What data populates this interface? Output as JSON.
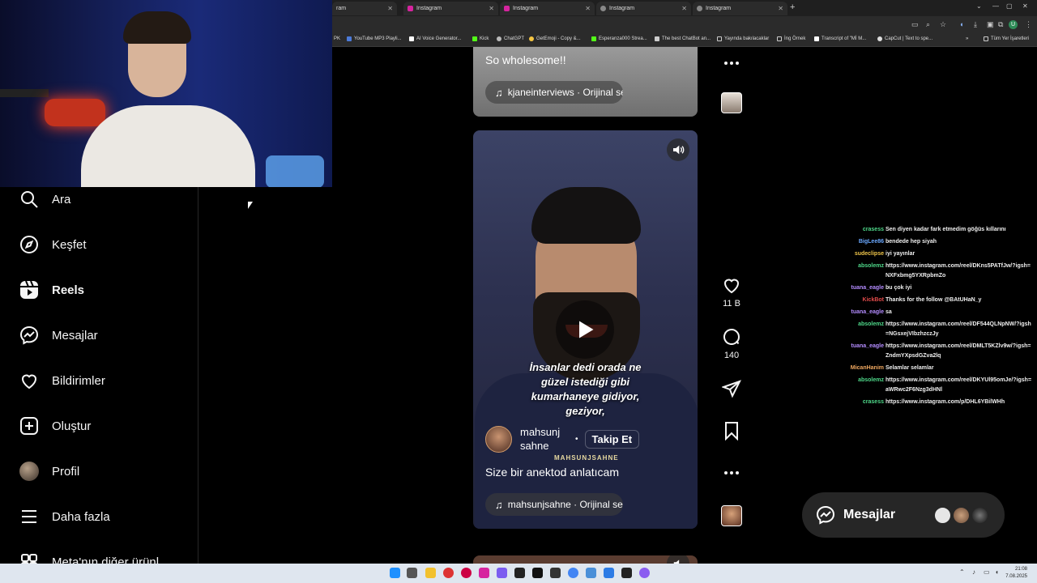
{
  "browser": {
    "tabs": [
      {
        "label": "ram"
      },
      {
        "label": "Instagram"
      },
      {
        "label": "Instagram"
      },
      {
        "label": "Instagram"
      },
      {
        "label": "Instagram"
      }
    ],
    "bookmarks": [
      "PK",
      "YouTube MP3 Playli...",
      "AI Voice Generator...",
      "Kick",
      "ChatGPT",
      "GetEmoji - Copy &...",
      "Esperanza000 Strea...",
      "The best ChatBot an...",
      "Yayında bakılacaklar",
      "İng Örnek",
      "Transcript of \"Mİ M...",
      "CapCut | Text to spe...",
      "»",
      "Tüm Yer İşaretleri"
    ],
    "profile_initial": "U"
  },
  "sidebar": {
    "items": [
      {
        "label": "Ara",
        "icon": "search-icon"
      },
      {
        "label": "Keşfet",
        "icon": "compass-icon"
      },
      {
        "label": "Reels",
        "icon": "reels-icon",
        "active": true
      },
      {
        "label": "Mesajlar",
        "icon": "messenger-icon"
      },
      {
        "label": "Bildirimler",
        "icon": "heart-icon"
      },
      {
        "label": "Oluştur",
        "icon": "plus-square-icon"
      },
      {
        "label": "Profil",
        "icon": "avatar"
      },
      {
        "label": "Daha fazla",
        "icon": "menu-icon"
      },
      {
        "label": "Meta'nın diğer ürünl",
        "icon": "meta-apps-icon"
      }
    ]
  },
  "reels": {
    "previous": {
      "caption": "So wholesome!!",
      "audio": "kjaneinterviews · Orijinal ses"
    },
    "current": {
      "overlay_text": [
        "İnsanlar dedi orada ne",
        "güzel istediği gibi",
        "kumarhaneye gidiyor,",
        "geziyor,"
      ],
      "author_line1": "mahsunj",
      "author_line2": "sahne",
      "dot": "•",
      "follow_label": "Takip Et",
      "watermark": "MAHSUNJSAHNE",
      "caption": "Size bir anektod anlatıcam",
      "audio": "mahsunjsahne · Orijinal ses",
      "likes": "11 B",
      "comments": "140"
    }
  },
  "chat": {
    "messages": [
      {
        "user": "crasess",
        "color": "#4fd98a",
        "text": "Sen diyen kadar fark etmedim göğüs kıllarını"
      },
      {
        "user": "BigLee86",
        "color": "#6aa8ff",
        "text": "bendede hep siyah"
      },
      {
        "user": "sudeclipse",
        "color": "#f0c64a",
        "text": "iyi yayınlar"
      },
      {
        "user": "absolemz",
        "color": "#4fd98a",
        "text": "https://www.instagram.com/reel/DKns5PATfJw/?igsh=NXFxbmg5YXRpbmZo"
      },
      {
        "user": "tuana_eagle",
        "color": "#b48cff",
        "text": "bu çok iyi"
      },
      {
        "user": "KickBot",
        "color": "#e24b4b",
        "text": "Thanks for the follow @BAtUHaN_y"
      },
      {
        "user": "tuana_eagle",
        "color": "#b48cff",
        "text": "sa"
      },
      {
        "user": "absolemz",
        "color": "#4fd98a",
        "text": "https://www.instagram.com/reel/DF544QLNpNW/?igsh=NGsxejVIbzhzczJy"
      },
      {
        "user": "tuana_eagle",
        "color": "#b48cff",
        "text": "https://www.instagram.com/reel/DMLT5KZlv9w/?igsh=ZndmYXpsdGZva2lq"
      },
      {
        "user": "MicanHanim",
        "color": "#f0a860",
        "text": "Selamlar selamlar"
      },
      {
        "user": "absolemz",
        "color": "#4fd98a",
        "text": "https://www.instagram.com/reel/DKYUl95omJe/?igsh=aWRwc2F6Nzg3dHNl"
      },
      {
        "user": "crasess",
        "color": "#4fd98a",
        "text": "https://www.instagram.com/p/DHL6YBilWHh"
      }
    ]
  },
  "messages_pill": {
    "label": "Mesajlar"
  },
  "taskbar": {
    "time": "21:08",
    "date": "7.08.2025"
  },
  "colors": {
    "background": "#000000",
    "sidebar_border": "#262626",
    "pill_bg": "#262626",
    "taskbar": "#dfe6ef"
  }
}
